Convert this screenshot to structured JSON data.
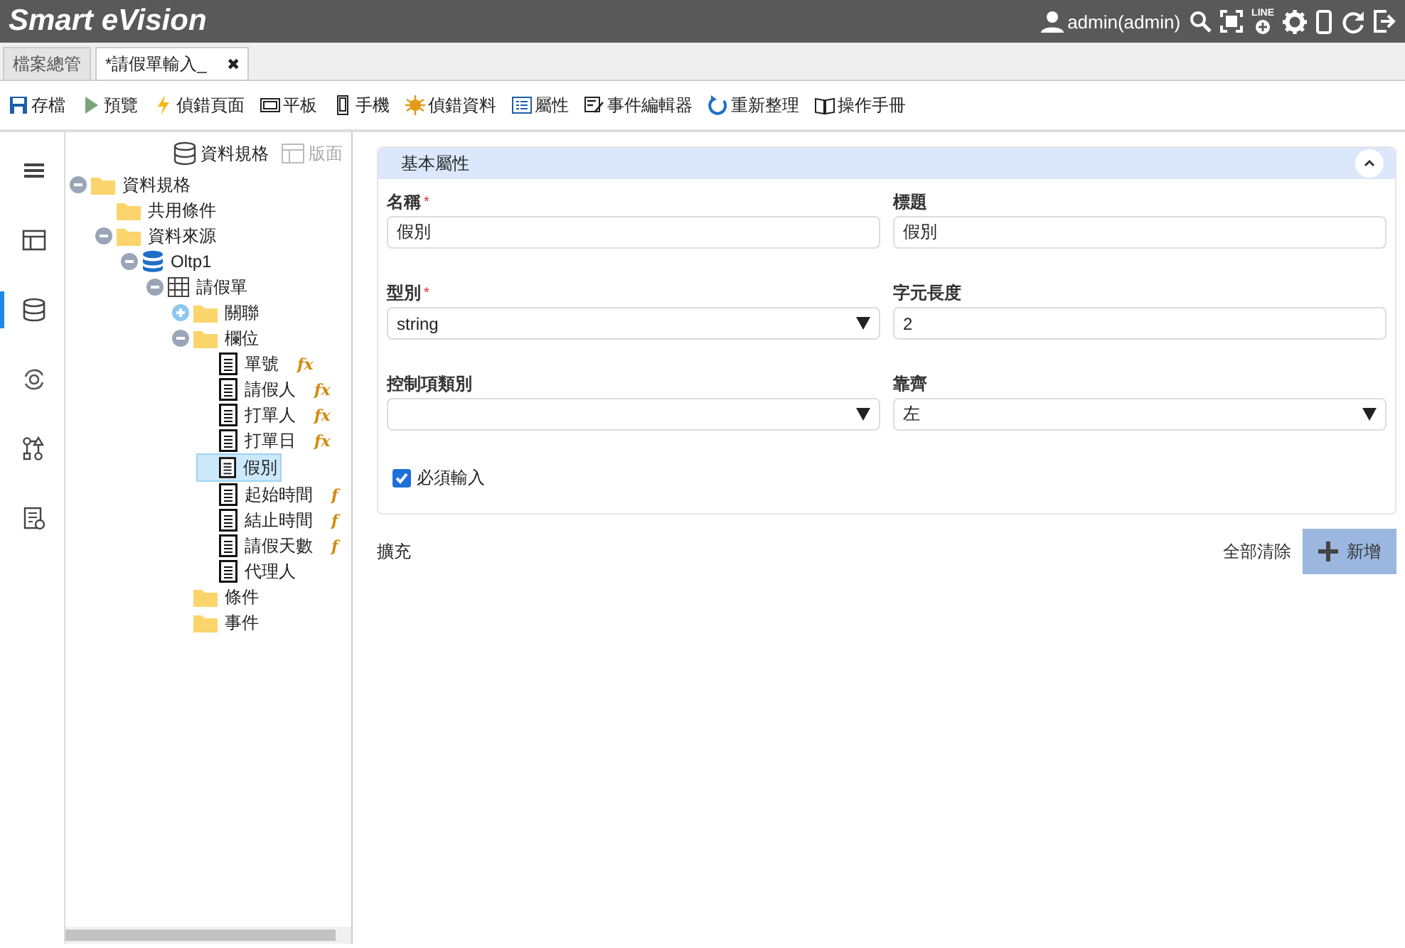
{
  "header": {
    "title": "Smart eVision",
    "user": "admin(admin)",
    "line_icon_text": "LINE"
  },
  "tabs": [
    {
      "label": "檔案總管",
      "selected": false
    },
    {
      "label": "*請假單輸入_",
      "selected": true,
      "close": "✖"
    }
  ],
  "toolbar": [
    {
      "kind": "save",
      "label": "存檔"
    },
    {
      "kind": "play",
      "label": "預覽"
    },
    {
      "kind": "bolt",
      "label": "偵錯頁面"
    },
    {
      "kind": "tablet",
      "label": "平板"
    },
    {
      "kind": "phone",
      "label": "手機"
    },
    {
      "kind": "bug",
      "label": "偵錯資料"
    },
    {
      "kind": "list",
      "label": "屬性"
    },
    {
      "kind": "edit",
      "label": "事件編輯器"
    },
    {
      "kind": "refresh",
      "label": "重新整理"
    },
    {
      "kind": "book",
      "label": "操作手冊"
    }
  ],
  "rail": [
    {
      "kind": "menu",
      "selected": false
    },
    {
      "kind": "layout",
      "selected": false
    },
    {
      "kind": "database",
      "selected": true
    },
    {
      "kind": "sync",
      "selected": false
    },
    {
      "kind": "flow",
      "selected": false
    },
    {
      "kind": "report",
      "selected": false
    }
  ],
  "tree_header": [
    {
      "kind": "database",
      "label": "資料規格",
      "disabled": false
    },
    {
      "kind": "layout",
      "label": "版面",
      "disabled": true
    }
  ],
  "tree": [
    {
      "kind": "folder",
      "label": "資料規格",
      "expanded": true,
      "children": [
        {
          "kind": "folder",
          "label": "共用條件"
        },
        {
          "kind": "folder",
          "label": "資料來源",
          "expanded": true,
          "children": [
            {
              "kind": "database",
              "label": "Oltp1",
              "expanded": true,
              "children": [
                {
                  "kind": "table",
                  "label": "請假單",
                  "expanded": true,
                  "children": [
                    {
                      "kind": "folder",
                      "label": "關聯",
                      "expanded": false
                    },
                    {
                      "kind": "folder",
                      "label": "欄位",
                      "expanded": true,
                      "children": [
                        {
                          "kind": "field",
                          "label": "單號",
                          "formula": "fx",
                          "selected": false
                        },
                        {
                          "kind": "field",
                          "label": "請假人",
                          "formula": "fx",
                          "selected": false
                        },
                        {
                          "kind": "field",
                          "label": "打單人",
                          "formula": "fx",
                          "selected": false
                        },
                        {
                          "kind": "field",
                          "label": "打單日",
                          "formula": "fx",
                          "selected": false
                        },
                        {
                          "kind": "field",
                          "label": "假別",
                          "selected": true
                        },
                        {
                          "kind": "field",
                          "label": "起始時間",
                          "formula": "f",
                          "selected": false
                        },
                        {
                          "kind": "field",
                          "label": "結止時間",
                          "formula": "f",
                          "selected": false
                        },
                        {
                          "kind": "field",
                          "label": "請假天數",
                          "formula": "f",
                          "selected": false
                        },
                        {
                          "kind": "field",
                          "label": "代理人",
                          "selected": false
                        }
                      ]
                    },
                    {
                      "kind": "folder",
                      "label": "條件"
                    },
                    {
                      "kind": "folder",
                      "label": "事件"
                    }
                  ]
                }
              ]
            }
          ]
        }
      ]
    }
  ],
  "panel": {
    "title": "基本屬性",
    "expanded": true,
    "fields": [
      {
        "label": "名稱",
        "required_mark": "*",
        "kind": "input",
        "value": "假別"
      },
      {
        "label": "標題",
        "kind": "input",
        "value": "假別"
      },
      {
        "label": "型別",
        "required_mark": "*",
        "kind": "select",
        "value": "string"
      },
      {
        "label": "字元長度",
        "kind": "input",
        "value": "2"
      },
      {
        "label": "控制項類別",
        "kind": "select"
      },
      {
        "label": "靠齊",
        "kind": "select",
        "value": "左"
      }
    ],
    "checkbox": {
      "label": "必須輸入",
      "checked": true
    }
  },
  "extension": {
    "label": "擴充",
    "clear": "全部清除",
    "add": "新增"
  }
}
